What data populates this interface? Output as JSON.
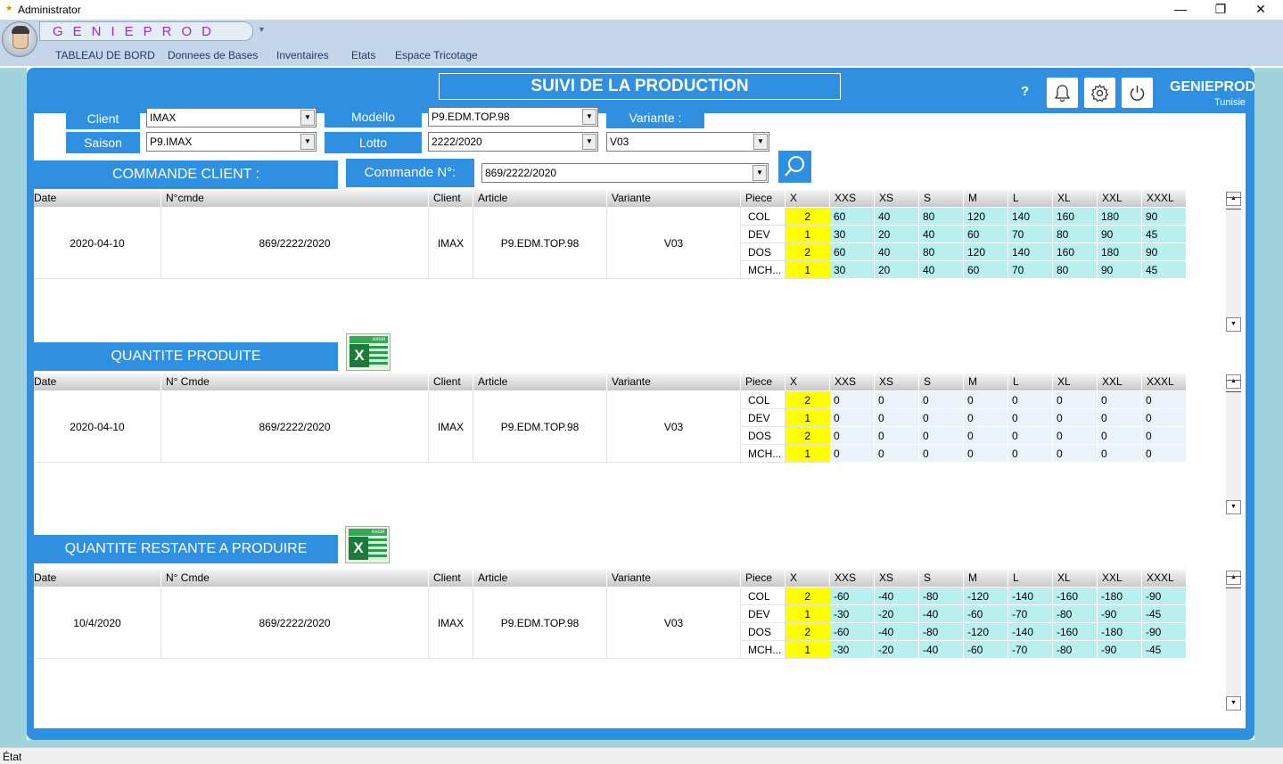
{
  "window": {
    "title": "Administrator"
  },
  "ribbon": {
    "brand": "GENIEPROD",
    "menu": [
      "TABLEAU DE BORD",
      "Donnees de Bases",
      "Inventaires",
      "Etats",
      "Espace Tricotage"
    ]
  },
  "header": {
    "title": "SUIVI DE LA PRODUCTION",
    "help": "?",
    "company": "GENIEPROD",
    "country": "Tunisie"
  },
  "filters": {
    "client_label": "Client",
    "client_value": "IMAX",
    "modello_label": "Modello",
    "modello_value": "P9.EDM.TOP.98",
    "variante_label": "Variante  :",
    "saison_label": "Saison",
    "saison_value": "P9.IMAX",
    "lotto_label": "Lotto",
    "lotto_value": "2222/2020",
    "variante_value": "V03",
    "commande_label": "Commande  N°:",
    "commande_value": "869/2222/2020"
  },
  "sections": [
    {
      "title": "COMMANDE CLIENT :",
      "columns": [
        "Date",
        "N°cmde",
        "Client",
        "Article",
        "Variante"
      ],
      "size_columns": [
        "Piece",
        "X",
        "XXS",
        "XS",
        "S",
        "M",
        "L",
        "XL",
        "XXL",
        "XXXL"
      ],
      "row": {
        "date": "2020-04-10",
        "cmde": "869/2222/2020",
        "client": "IMAX",
        "article": "P9.EDM.TOP.98",
        "variante": "V03"
      },
      "pieces": [
        {
          "piece": "COL",
          "x": "2",
          "sizes": [
            "60",
            "40",
            "80",
            "120",
            "140",
            "160",
            "180",
            "90"
          ]
        },
        {
          "piece": "DEV",
          "x": "1",
          "sizes": [
            "30",
            "20",
            "40",
            "60",
            "70",
            "80",
            "90",
            "45"
          ]
        },
        {
          "piece": "DOS",
          "x": "2",
          "sizes": [
            "60",
            "40",
            "80",
            "120",
            "140",
            "160",
            "180",
            "90"
          ]
        },
        {
          "piece": "MCH...",
          "x": "1",
          "sizes": [
            "30",
            "20",
            "40",
            "60",
            "70",
            "80",
            "90",
            "45"
          ]
        }
      ],
      "size_bg": "#b8f0ef"
    },
    {
      "title": "QUANTITE  PRODUITE",
      "columns": [
        "Date",
        "N° Cmde",
        "Client",
        "Article",
        "Variante"
      ],
      "size_columns": [
        "Piece",
        "X",
        "XXS",
        "XS",
        "S",
        "M",
        "L",
        "XL",
        "XXL",
        "XXXL"
      ],
      "row": {
        "date": "2020-04-10",
        "cmde": "869/2222/2020",
        "client": "IMAX",
        "article": "P9.EDM.TOP.98",
        "variante": "V03"
      },
      "pieces": [
        {
          "piece": "COL",
          "x": "2",
          "sizes": [
            "0",
            "0",
            "0",
            "0",
            "0",
            "0",
            "0",
            "0"
          ]
        },
        {
          "piece": "DEV",
          "x": "1",
          "sizes": [
            "0",
            "0",
            "0",
            "0",
            "0",
            "0",
            "0",
            "0"
          ]
        },
        {
          "piece": "DOS",
          "x": "2",
          "sizes": [
            "0",
            "0",
            "0",
            "0",
            "0",
            "0",
            "0",
            "0"
          ]
        },
        {
          "piece": "MCH...",
          "x": "1",
          "sizes": [
            "0",
            "0",
            "0",
            "0",
            "0",
            "0",
            "0",
            "0"
          ]
        }
      ],
      "size_bg": "#eaf3fb",
      "excel_label": "excel"
    },
    {
      "title": "QUANTITE RESTANTE A PRODUIRE",
      "columns": [
        "Date",
        "N° Cmde",
        "Client",
        "Article",
        "Variante"
      ],
      "size_columns": [
        "Piece",
        "X",
        "XXS",
        "XS",
        "S",
        "M",
        "L",
        "XL",
        "XXL",
        "XXXL"
      ],
      "row": {
        "date": "10/4/2020",
        "cmde": "869/2222/2020",
        "client": "IMAX",
        "article": "P9.EDM.TOP.98",
        "variante": "V03"
      },
      "pieces": [
        {
          "piece": "COL",
          "x": "2",
          "sizes": [
            "-60",
            "-40",
            "-80",
            "-120",
            "-140",
            "-160",
            "-180",
            "-90"
          ]
        },
        {
          "piece": "DEV",
          "x": "1",
          "sizes": [
            "-30",
            "-20",
            "-40",
            "-60",
            "-70",
            "-80",
            "-90",
            "-45"
          ]
        },
        {
          "piece": "DOS",
          "x": "2",
          "sizes": [
            "-60",
            "-40",
            "-80",
            "-120",
            "-140",
            "-160",
            "-180",
            "-90"
          ]
        },
        {
          "piece": "MCH...",
          "x": "1",
          "sizes": [
            "-30",
            "-20",
            "-40",
            "-60",
            "-70",
            "-80",
            "-90",
            "-45"
          ]
        }
      ],
      "size_bg": "#b8f0ef",
      "excel_label": "excel"
    }
  ],
  "status": {
    "text": "État"
  },
  "colors": {
    "frame": "#2f8fe0",
    "highlight": "#ffff00"
  }
}
